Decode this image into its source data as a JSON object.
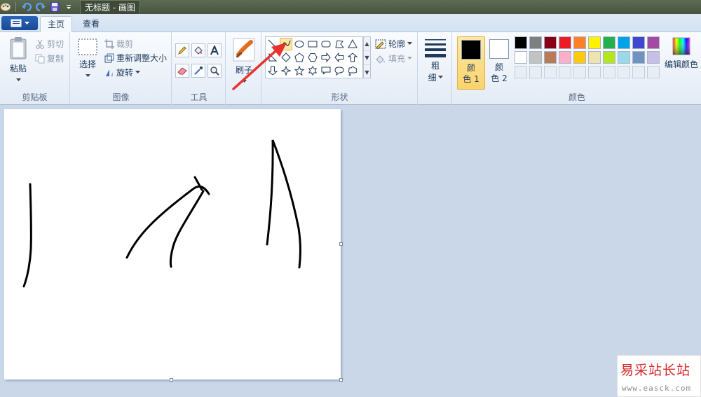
{
  "window": {
    "title": "无标题 - 画图"
  },
  "tabs": [
    {
      "label": "主页",
      "active": true
    },
    {
      "label": "查看",
      "active": false
    }
  ],
  "groups": {
    "clipboard": {
      "label": "剪贴板",
      "paste": "粘贴",
      "cut": "剪切",
      "copy": "复制"
    },
    "image": {
      "label": "图像",
      "select": "选择",
      "crop": "裁剪",
      "resize": "重新调整大小",
      "rotate": "旋转"
    },
    "tools": {
      "label": "工具"
    },
    "brush": {
      "label": "刷子"
    },
    "shapes": {
      "label": "形状",
      "outline": "轮廓",
      "fill": "填充"
    },
    "size": {
      "label_1": "粗",
      "label_2": "细"
    },
    "colors": {
      "label": "颜色",
      "color1_line1": "颜",
      "color1_line2": "色 1",
      "color2_line1": "颜",
      "color2_line2": "色 2",
      "edit": "编辑颜色",
      "color1_value": "#000000",
      "color2_value": "#ffffff",
      "palette_row1": [
        "#000000",
        "#7f7f7f",
        "#880015",
        "#ed1c24",
        "#ff7f27",
        "#fff200",
        "#22b14c",
        "#00a2e8",
        "#3f48cc",
        "#a349a4"
      ],
      "palette_row2": [
        "#ffffff",
        "#c3c3c3",
        "#b97a57",
        "#ffaec9",
        "#ffc90e",
        "#efe4b0",
        "#b5e61d",
        "#99d9ea",
        "#7092be",
        "#c8bfe7"
      ]
    }
  },
  "watermark": {
    "title": "易采站长站",
    "url": "www.easck.com"
  }
}
